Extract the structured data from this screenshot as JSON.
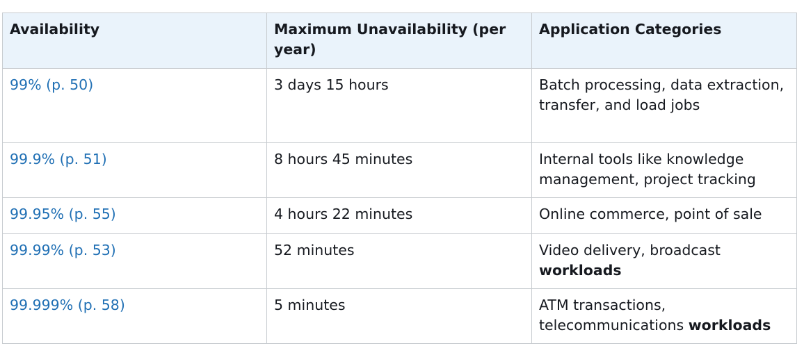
{
  "headers": {
    "availability": "Availability",
    "max_unavailability": "Maximum Unavailability (per year)",
    "categories": "Application Categories"
  },
  "rows": [
    {
      "availability": "99% (p. 50)",
      "max_unavailability": "3 days 15 hours",
      "categories": "Batch processing, data extraction, transfer, and load jobs",
      "categories_bold": ""
    },
    {
      "availability": "99.9% (p. 51)",
      "max_unavailability": "8 hours 45 minutes",
      "categories": "Internal tools like knowledge management, project tracking",
      "categories_bold": ""
    },
    {
      "availability": "99.95% (p. 55)",
      "max_unavailability": "4 hours 22 minutes",
      "categories": "Online commerce, point of sale",
      "categories_bold": ""
    },
    {
      "availability": "99.99% (p. 53)",
      "max_unavailability": "52 minutes",
      "categories": "Video delivery, broadcast ",
      "categories_bold": "workloads"
    },
    {
      "availability": "99.999% (p. 58)",
      "max_unavailability": "5 minutes",
      "categories": "ATM transactions, telecommunications ",
      "categories_bold": "workloads"
    }
  ],
  "colors": {
    "header_background": "#eaf3fb",
    "link": "#1f6fb4",
    "border": "#c7cbcf",
    "text": "#16191f"
  }
}
